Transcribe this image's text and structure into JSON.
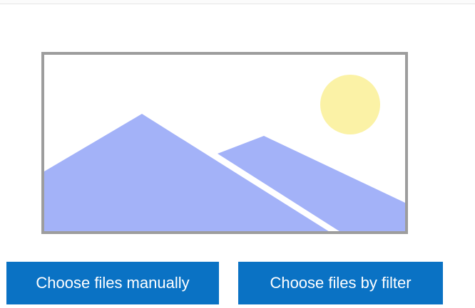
{
  "placeholder": {
    "icon": "image-placeholder-icon",
    "colors": {
      "frame": "#9d9d9d",
      "sky": "#ffffff",
      "mountains": "#a3b2f8",
      "sun": "#fbf2a6"
    }
  },
  "actions": {
    "choose_manually_label": "Choose files manually",
    "choose_by_filter_label": "Choose files by filter",
    "button_color": "#0a72c4",
    "button_text_color": "#ffffff"
  }
}
